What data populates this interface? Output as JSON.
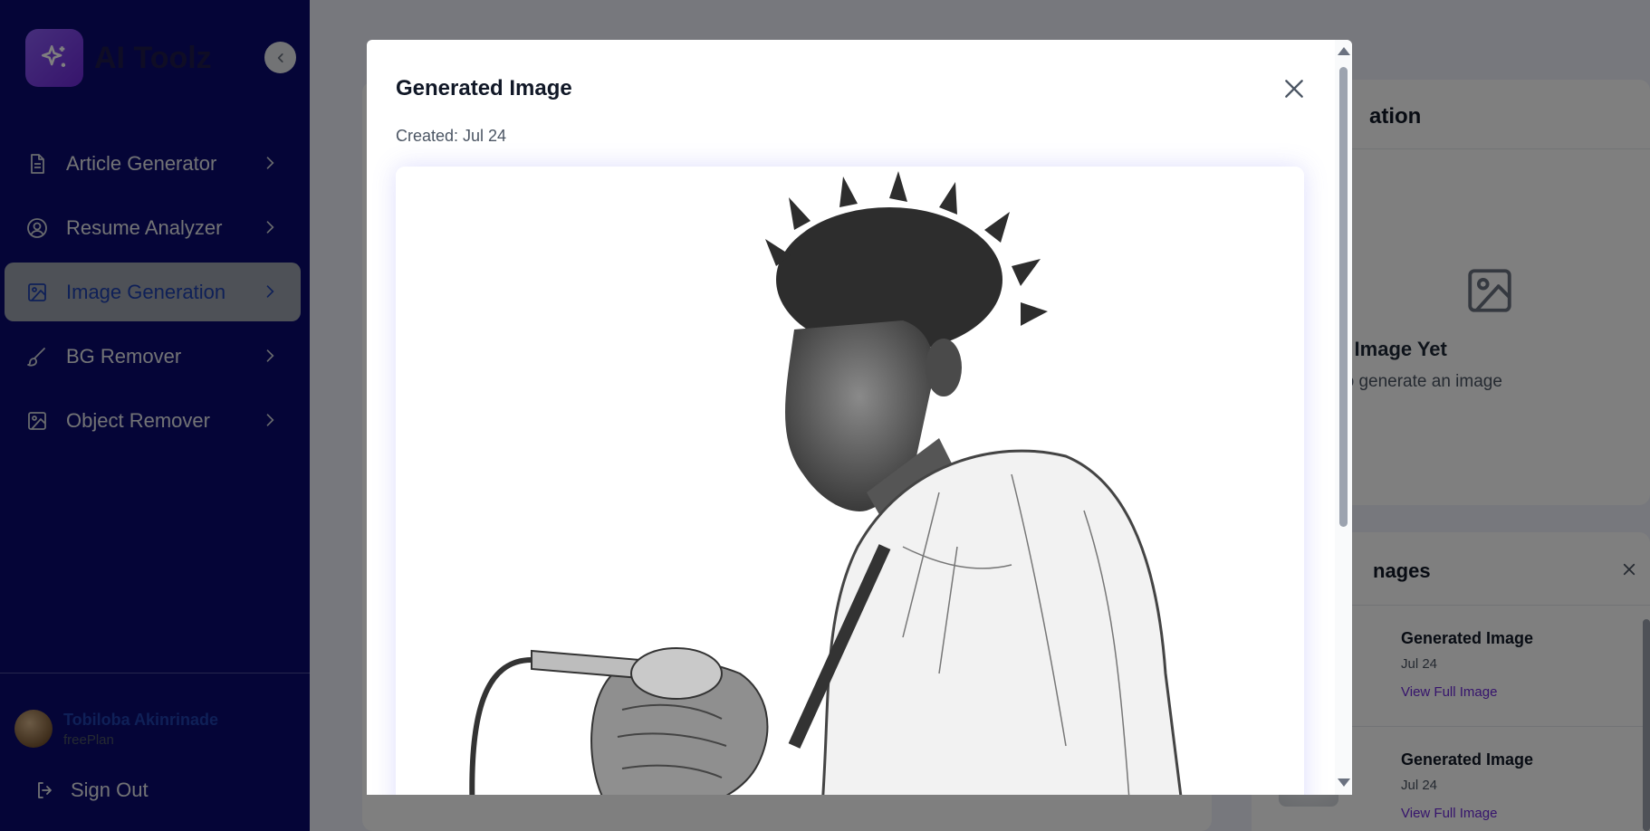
{
  "brand": {
    "name": "AI Toolz",
    "logo_icon": "sparkles-icon"
  },
  "sidebar": {
    "items": [
      {
        "label": "Article Generator",
        "icon": "document-icon"
      },
      {
        "label": "Resume Analyzer",
        "icon": "user-circle-icon"
      },
      {
        "label": "Image Generation",
        "icon": "image-icon"
      },
      {
        "label": "BG Remover",
        "icon": "brush-icon"
      },
      {
        "label": "Object Remover",
        "icon": "image-icon"
      }
    ],
    "active_index": 2
  },
  "user": {
    "name": "Tobiloba Akinrinade",
    "plan": "freePlan"
  },
  "signout_label": "Sign Out",
  "right_panel": {
    "title_fragment": "ation",
    "empty_title": "No Image Yet",
    "empty_subtitle": "a prompt to generate an image"
  },
  "recent": {
    "title_fragment": "nages",
    "items": [
      {
        "title": "Generated Image",
        "date": "Jul 24",
        "link": "View Full Image"
      },
      {
        "title": "Generated Image",
        "date": "Jul 24",
        "link": "View Full Image"
      }
    ]
  },
  "modal": {
    "title": "Generated Image",
    "created": "Created: Jul 24",
    "image_description_icon": "pencil-sketch-image"
  },
  "colors": {
    "sidebar_bg": "#0b0a6e",
    "active_item_bg": "#9ca3af",
    "active_item_text": "#1e40af",
    "accent_purple": "#6d28d9",
    "overlay": "rgba(0,0,0,0.5)"
  }
}
